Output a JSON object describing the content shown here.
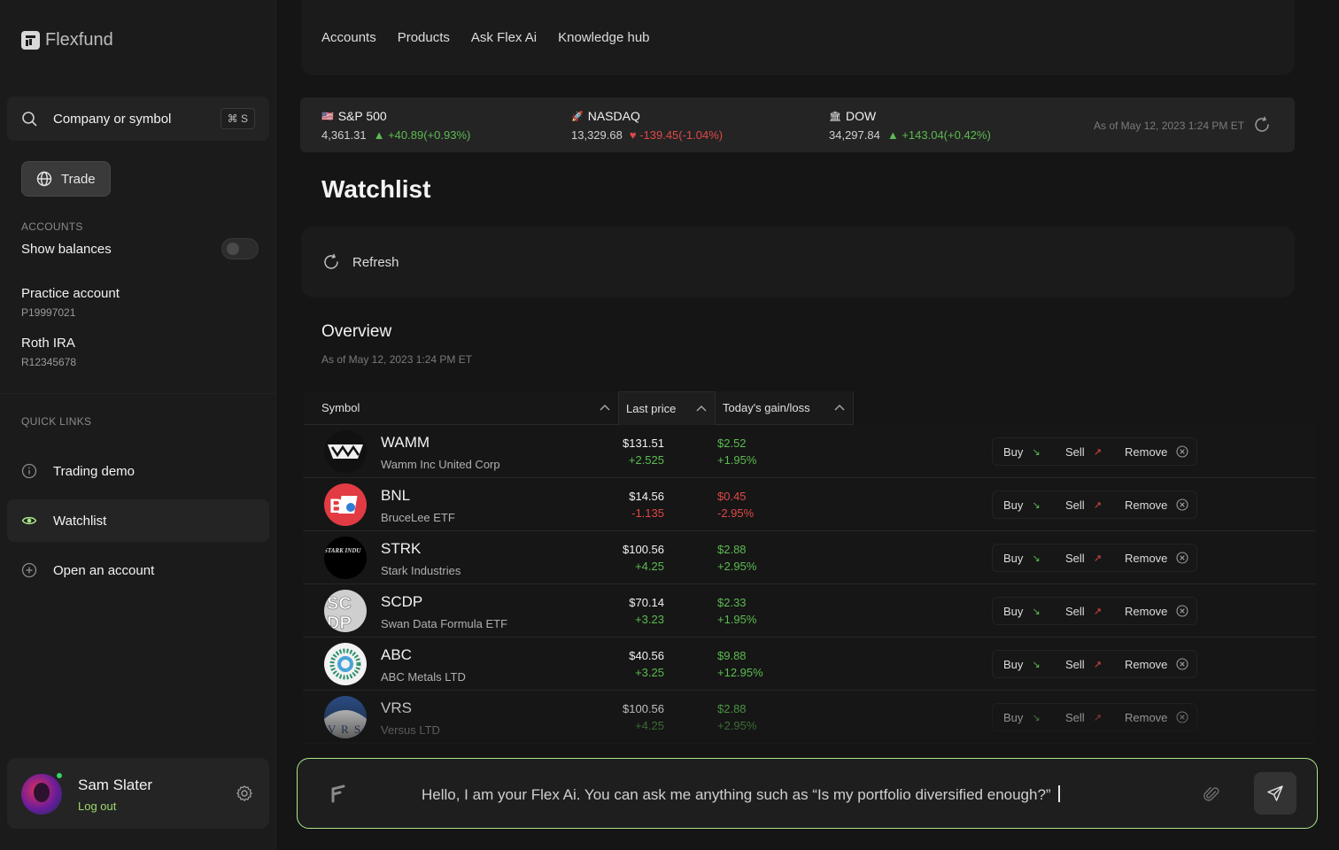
{
  "brand": {
    "name": "Flexfund"
  },
  "search": {
    "label": "Company or symbol",
    "shortcut": "⌘ S"
  },
  "sidebar": {
    "trade_label": "Trade",
    "accounts_heading": "ACCOUNTS",
    "show_balances": "Show balances",
    "show_balances_on": false,
    "accounts": [
      {
        "name": "Practice account",
        "id": "P19997021"
      },
      {
        "name": "Roth IRA",
        "id": "R12345678"
      }
    ],
    "quick_links_heading": "QUICK LINKS",
    "links": [
      {
        "label": "Trading demo",
        "icon": "info-icon"
      },
      {
        "label": "Watchlist",
        "icon": "eye-icon",
        "active": true
      },
      {
        "label": "Open an account",
        "icon": "plus-circle-icon"
      }
    ]
  },
  "user": {
    "name": "Sam Slater",
    "logout": "Log out"
  },
  "topnav": [
    "Accounts",
    "Products",
    "Ask Flex Ai",
    "Knowledge hub"
  ],
  "ticker": {
    "items": [
      {
        "flag": "🇺🇸",
        "name": "S&P 500",
        "value": "4,361.31",
        "change": "+40.89(+0.93%)",
        "dir": "up"
      },
      {
        "flag": "🚀",
        "name": "NASDAQ",
        "value": "13,329.68",
        "change": "-139.45(-1.04%)",
        "dir": "down"
      },
      {
        "flag": "🏛",
        "name": "DOW",
        "value": "34,297.84",
        "change": "+143.04(+0.42%)",
        "dir": "up"
      }
    ],
    "as_of": "As of May 12, 2023 1:24 PM ET"
  },
  "page": {
    "title": "Watchlist",
    "refresh_label": "Refresh"
  },
  "overview": {
    "title": "Overview",
    "as_of": "As of May 12, 2023 1:24 PM ET",
    "columns": [
      "Symbol",
      "Last price",
      "Today's gain/loss"
    ],
    "action_labels": {
      "buy": "Buy",
      "sell": "Sell",
      "remove": "Remove"
    },
    "rows": [
      {
        "symbol": "WAMM",
        "name": "Wamm Inc United Corp",
        "price": "$131.51",
        "change": "+2.525",
        "gain": "$2.52",
        "pct": "+1.95%",
        "dir": "up",
        "logo": "wamm"
      },
      {
        "symbol": "BNL",
        "name": "BruceLee ETF",
        "price": "$14.56",
        "change": "-1.135",
        "gain": "$0.45",
        "pct": "-2.95%",
        "dir": "down",
        "logo": "bnl"
      },
      {
        "symbol": "STRK",
        "name": "Stark Industries",
        "price": "$100.56",
        "change": "+4.25",
        "gain": "$2.88",
        "pct": "+2.95%",
        "dir": "up",
        "logo": "strk"
      },
      {
        "symbol": "SCDP",
        "name": "Swan Data Formula ETF",
        "price": "$70.14",
        "change": "+3.23",
        "gain": "$2.33",
        "pct": "+1.95%",
        "dir": "up",
        "logo": "scdp"
      },
      {
        "symbol": "ABC",
        "name": "ABC Metals LTD",
        "price": "$40.56",
        "change": "+3.25",
        "gain": "$9.88",
        "pct": "+12.95%",
        "dir": "up",
        "logo": "abc"
      },
      {
        "symbol": "VRS",
        "name": "Versus LTD",
        "price": "$100.56",
        "change": "+4.25",
        "gain": "$2.88",
        "pct": "+2.95%",
        "dir": "up",
        "logo": "vrs"
      }
    ]
  },
  "chat": {
    "placeholder": "Hello, I am your Flex Ai. You can ask me anything such as “Is my portfolio diversified enough?”"
  },
  "colors": {
    "accent": "#a9e88b",
    "up": "#5bbb50",
    "down": "#e04848",
    "background": "#151515"
  }
}
